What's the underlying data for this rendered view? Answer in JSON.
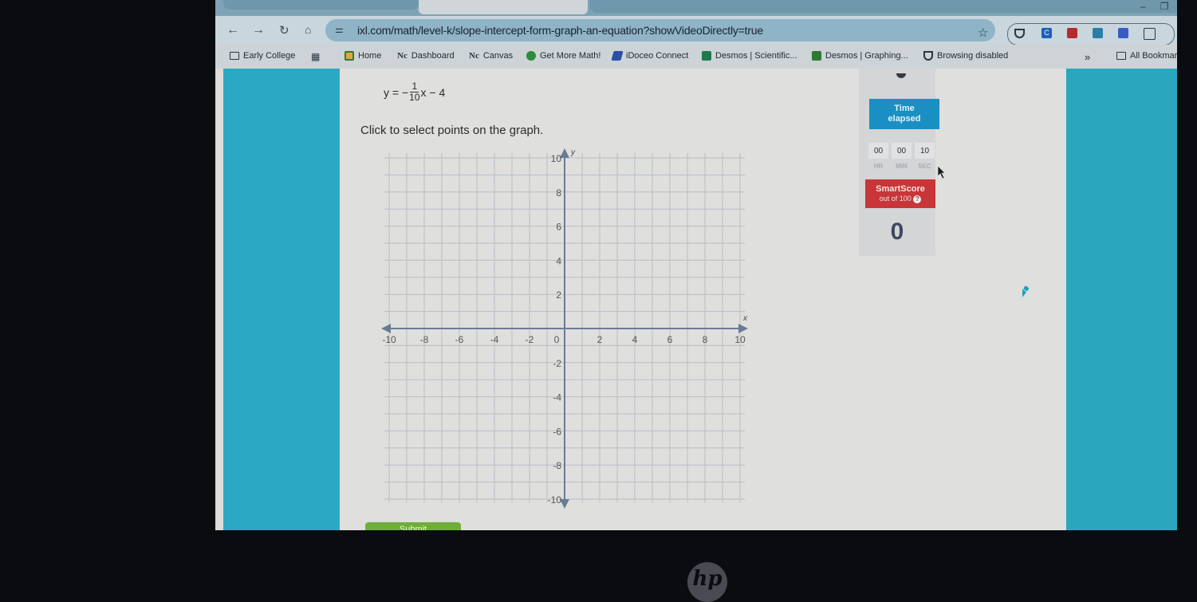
{
  "browser": {
    "url": "ixl.com/math/level-k/slope-intercept-form-graph-an-equation?showVideoDirectly=true",
    "window_controls": [
      "minimize",
      "restore",
      "close"
    ],
    "nav_buttons": [
      "back",
      "forward",
      "reload",
      "home"
    ],
    "extensions": [
      {
        "name": "shield-extension",
        "color": "#2c3640"
      },
      {
        "name": "c-extension",
        "color": "#1f5fb5"
      },
      {
        "name": "red-book-extension",
        "color": "#b22c2c"
      },
      {
        "name": "cloud-extension",
        "color": "#2a7fa6"
      },
      {
        "name": "iw-extension",
        "color": "#3b5bc4"
      },
      {
        "name": "puzzle-extension",
        "color": "#2a3842"
      }
    ],
    "bookmarks": [
      {
        "label": "Early College",
        "icon": "folder-gear-icon"
      },
      {
        "label": "",
        "icon": "apps-grid-icon"
      },
      {
        "label": "Home",
        "icon": "classroom-icon"
      },
      {
        "label": "Dashboard",
        "icon": "nc-logo-icon"
      },
      {
        "label": "Canvas",
        "icon": "nc-logo-icon"
      },
      {
        "label": "Get More Math!",
        "icon": "gmm-icon"
      },
      {
        "label": "iDoceo Connect",
        "icon": "idoceo-icon"
      },
      {
        "label": "Desmos | Scientific...",
        "icon": "desmos-scientific-icon"
      },
      {
        "label": "Desmos | Graphing...",
        "icon": "desmos-graphing-icon"
      },
      {
        "label": "Browsing disabled",
        "icon": "shield-icon"
      }
    ],
    "overflow_label": "»",
    "all_bookmarks_label": "All Bookmarks"
  },
  "problem": {
    "equation_prefix": "y = −",
    "fraction_numerator": "1",
    "fraction_denominator": "10",
    "equation_suffix": "x − 4",
    "instruction": "Click to select points on the graph."
  },
  "graph": {
    "x_axis_label": "x",
    "y_axis_label": "y",
    "xlim": [
      -10,
      10
    ],
    "ylim": [
      -10,
      10
    ],
    "grid_step": 1,
    "label_step": 2,
    "x_tick_labels": [
      "-10",
      "-8",
      "-6",
      "-4",
      "-2",
      "0",
      "2",
      "4",
      "6",
      "8",
      "10"
    ],
    "y_tick_labels": [
      "10",
      "8",
      "6",
      "4",
      "2",
      "-2",
      "-4",
      "-6",
      "-8",
      "-10"
    ],
    "axis_color": "#6a7c94",
    "grid_color": "#b8bec6"
  },
  "stats": {
    "time_label_line1": "Time",
    "time_label_line2": "elapsed",
    "timer": {
      "hr": "00",
      "min": "00",
      "sec": "10"
    },
    "timer_units": {
      "hr": "HR",
      "min": "MIN",
      "sec": "SEC"
    },
    "smartscore_title": "SmartScore",
    "smartscore_subtitle": "out of 100",
    "help_icon": "?",
    "score": "0"
  },
  "actions": {
    "submit_label": "Submit"
  },
  "device": {
    "logo": "hp"
  }
}
